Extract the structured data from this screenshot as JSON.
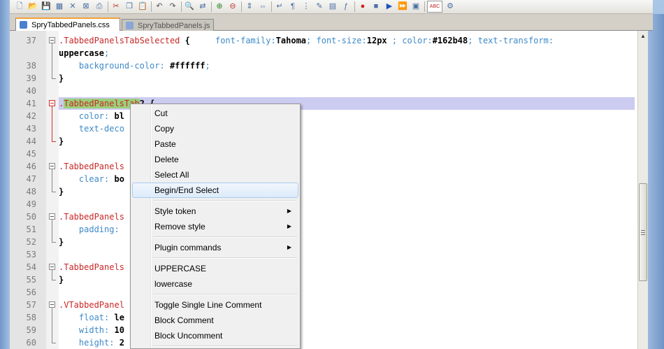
{
  "toolbar": {
    "icons": [
      "new-file-icon",
      "open-folder-icon",
      "save-icon",
      "save-all-icon",
      "close-icon",
      "close-all-icon",
      "print-icon",
      "cut-icon",
      "copy-icon",
      "paste-icon",
      "undo-icon",
      "redo-icon",
      "find-icon",
      "replace-icon",
      "zoom-in-icon",
      "zoom-out-icon",
      "sync-v-icon",
      "sync-h-icon",
      "word-wrap-icon",
      "show-all-chars-icon",
      "indent-guide-icon",
      "lang-icon",
      "doc-map-icon",
      "function-list-icon",
      "record-macro-icon",
      "stop-macro-icon",
      "play-macro-icon",
      "run-macro-multiple-icon",
      "save-macro-icon",
      "spell-check-icon",
      "spell-options-icon"
    ]
  },
  "tabs": [
    {
      "label": "SpryTabbedPanels.css",
      "active": true
    },
    {
      "label": "SpryTabbedPanels.js",
      "active": false
    }
  ],
  "editor": {
    "lines": [
      {
        "num": "37",
        "parts": [
          {
            "t": ".TabbedPanelsTabSelected",
            "c": "sel"
          },
          {
            "t": " ",
            "c": ""
          },
          {
            "t": "{",
            "c": "brace"
          },
          {
            "t": "     font-family:",
            "c": "prop"
          },
          {
            "t": "Tahoma",
            "c": "val"
          },
          {
            "t": "; font-size:",
            "c": "prop"
          },
          {
            "t": "12px",
            "c": "val"
          },
          {
            "t": " ; color:",
            "c": "prop"
          },
          {
            "t": "#162b48",
            "c": "val"
          },
          {
            "t": "; text-transform:",
            "c": "prop"
          }
        ]
      },
      {
        "num": "",
        "parts": [
          {
            "t": "uppercase",
            "c": "val"
          },
          {
            "t": ";",
            "c": "prop"
          }
        ]
      },
      {
        "num": "38",
        "parts": [
          {
            "t": "    background-color: ",
            "c": "prop"
          },
          {
            "t": "#ffffff",
            "c": "val"
          },
          {
            "t": ";",
            "c": "prop"
          }
        ]
      },
      {
        "num": "39",
        "parts": [
          {
            "t": "}",
            "c": "brace"
          }
        ]
      },
      {
        "num": "40",
        "parts": []
      },
      {
        "num": "41",
        "parts": [
          {
            "t": ".",
            "c": "sel"
          },
          {
            "t": "TabbedPanelsTab",
            "c": "sel selhl"
          },
          {
            "t": "2 {",
            "c": "brace"
          }
        ]
      },
      {
        "num": "42",
        "parts": [
          {
            "t": "    color: ",
            "c": "prop"
          },
          {
            "t": "bl",
            "c": "val"
          }
        ]
      },
      {
        "num": "43",
        "parts": [
          {
            "t": "    text-deco",
            "c": "prop"
          }
        ]
      },
      {
        "num": "44",
        "parts": [
          {
            "t": "}",
            "c": "brace"
          }
        ]
      },
      {
        "num": "45",
        "parts": []
      },
      {
        "num": "46",
        "parts": [
          {
            "t": ".TabbedPanels",
            "c": "sel"
          }
        ]
      },
      {
        "num": "47",
        "parts": [
          {
            "t": "    clear: ",
            "c": "prop"
          },
          {
            "t": "bo",
            "c": "val"
          }
        ]
      },
      {
        "num": "48",
        "parts": [
          {
            "t": "}",
            "c": "brace"
          }
        ]
      },
      {
        "num": "49",
        "parts": []
      },
      {
        "num": "50",
        "parts": [
          {
            "t": ".TabbedPanels",
            "c": "sel"
          }
        ]
      },
      {
        "num": "51",
        "parts": [
          {
            "t": "    padding:",
            "c": "prop"
          }
        ]
      },
      {
        "num": "52",
        "parts": [
          {
            "t": "}",
            "c": "brace"
          }
        ]
      },
      {
        "num": "53",
        "parts": []
      },
      {
        "num": "54",
        "parts": [
          {
            "t": ".TabbedPanels",
            "c": "sel"
          }
        ]
      },
      {
        "num": "55",
        "parts": [
          {
            "t": "}",
            "c": "brace"
          }
        ]
      },
      {
        "num": "56",
        "parts": []
      },
      {
        "num": "57",
        "parts": [
          {
            "t": ".VTabbedPanel",
            "c": "sel"
          }
        ]
      },
      {
        "num": "58",
        "parts": [
          {
            "t": "    float: ",
            "c": "prop"
          },
          {
            "t": "le",
            "c": "val"
          }
        ]
      },
      {
        "num": "59",
        "parts": [
          {
            "t": "    width: ",
            "c": "prop"
          },
          {
            "t": "10",
            "c": "val"
          }
        ]
      },
      {
        "num": "60",
        "parts": [
          {
            "t": "    height: ",
            "c": "prop"
          },
          {
            "t": "2",
            "c": "val"
          }
        ]
      }
    ]
  },
  "context_menu": {
    "items": [
      {
        "label": "Cut",
        "submenu": false
      },
      {
        "label": "Copy",
        "submenu": false
      },
      {
        "label": "Paste",
        "submenu": false
      },
      {
        "label": "Delete",
        "submenu": false
      },
      {
        "label": "Select All",
        "submenu": false
      },
      {
        "label": "Begin/End Select",
        "submenu": false,
        "hover": true
      },
      {
        "sep": true
      },
      {
        "label": "Style token",
        "submenu": true
      },
      {
        "label": "Remove style",
        "submenu": true
      },
      {
        "sep": true
      },
      {
        "label": "Plugin commands",
        "submenu": true
      },
      {
        "sep": true
      },
      {
        "label": "UPPERCASE",
        "submenu": false
      },
      {
        "label": "lowercase",
        "submenu": false
      },
      {
        "sep": true
      },
      {
        "label": "Toggle Single Line Comment",
        "submenu": false
      },
      {
        "label": "Block Comment",
        "submenu": false
      },
      {
        "label": "Block Uncomment",
        "submenu": false
      },
      {
        "sep": true
      }
    ]
  },
  "colors": {
    "selector": "#c82828",
    "property": "#3e8ac8",
    "current_line": "#cccbf0",
    "match_highlight": "#9bd07a",
    "active_tab_accent": "#f2a23a"
  }
}
